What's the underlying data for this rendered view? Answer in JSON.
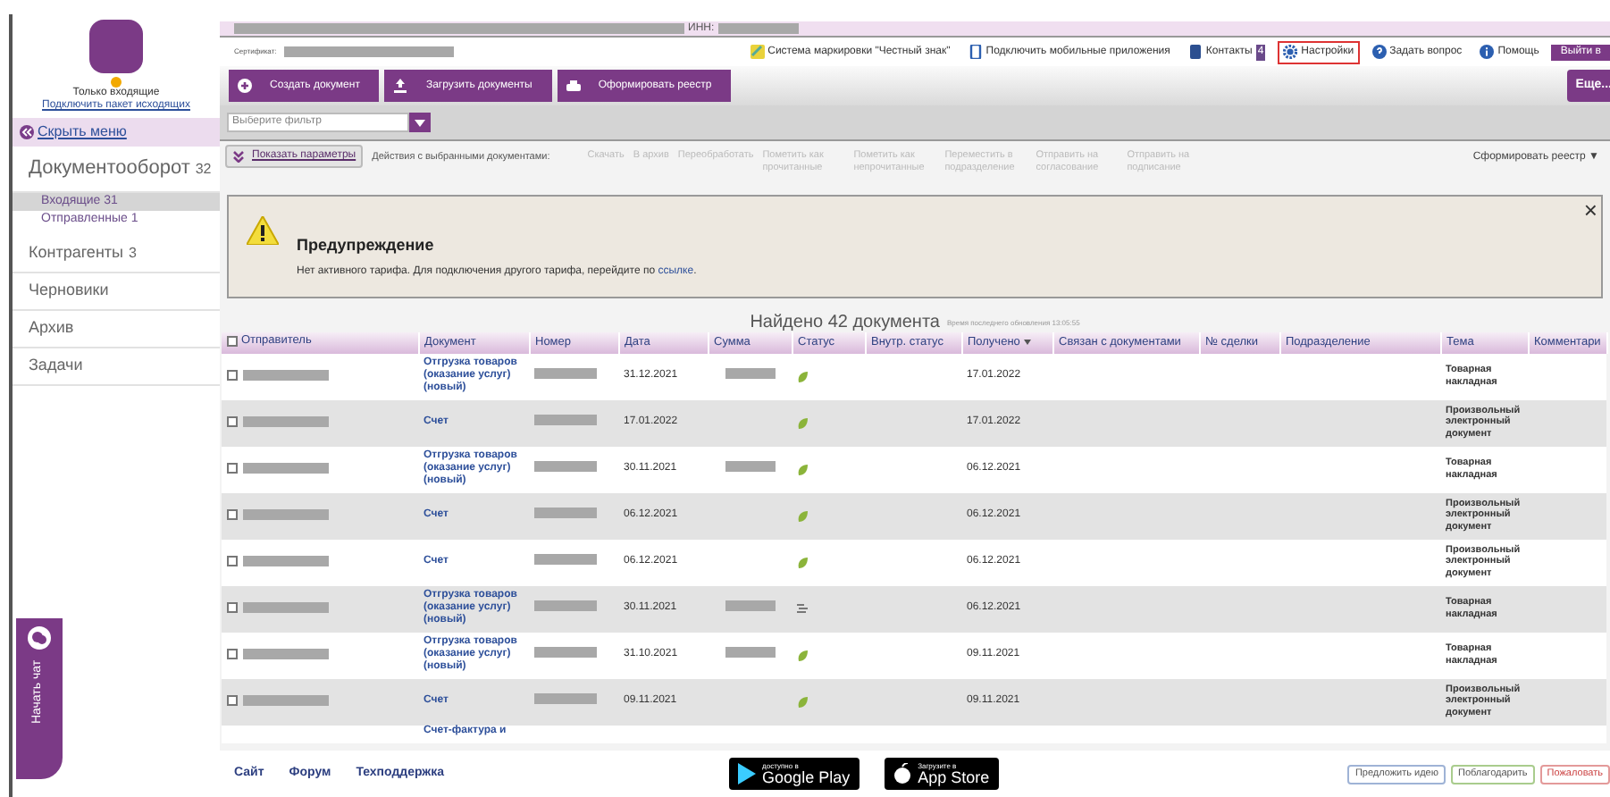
{
  "header": {
    "inn_label": "ИНН:",
    "certificate_label": "Сертификат:",
    "links": [
      {
        "kind": "mark",
        "label": "Система маркировки \"Честный знак\"",
        "highlighted": false
      },
      {
        "kind": "phone",
        "label": "Подключить мобильные приложения",
        "highlighted": false
      },
      {
        "kind": "book",
        "label": "Контакты",
        "badge": "4",
        "highlighted": false
      },
      {
        "kind": "gear",
        "label": "Настройки",
        "highlighted": true
      },
      {
        "kind": "question",
        "label": "Задать вопрос",
        "highlighted": false
      },
      {
        "kind": "info",
        "label": "Помощь",
        "highlighted": false
      }
    ],
    "logout": "Выйти в"
  },
  "sidebar": {
    "plan": "Только входящие",
    "plan_link": "Подключить пакет исходящих",
    "hide_menu": "Скрыть меню",
    "items": [
      {
        "label": "Документооборот",
        "count": "32",
        "children": [
          {
            "label": "Входящие",
            "count": "31",
            "selected": true
          },
          {
            "label": "Отправленные",
            "count": "1",
            "selected": false
          }
        ]
      },
      {
        "label": "Контрагенты",
        "count": "3"
      },
      {
        "label": "Черновики"
      },
      {
        "label": "Архив"
      },
      {
        "label": "Задачи"
      }
    ],
    "chat": "Начать чат"
  },
  "toolbar": {
    "buttons": [
      {
        "kind": "plus",
        "label": "Создать документ"
      },
      {
        "kind": "upload",
        "label": "Загрузить документы"
      },
      {
        "kind": "register",
        "label": "Оформировать реестр"
      }
    ],
    "more": "Еще..."
  },
  "filter": {
    "placeholder": "Выберите фильтр"
  },
  "actions": {
    "show_params": "Показать параметры",
    "label": "Действия с выбранными документами:",
    "items": [
      "Скачать",
      "В архив",
      "Переобработать",
      "Пометить как прочитанные",
      "Пометить как непрочитанные",
      "Переместить в подразделение",
      "Отправить на согласование",
      "Отправить на подписание"
    ],
    "register": "Сформировать реестр ▼"
  },
  "warning": {
    "title": "Предупреждение",
    "text": "Нет активного тарифа. Для подключения другого тарифа, перейдите по",
    "link": "ссылке",
    "end": ".",
    "close": "×"
  },
  "found": {
    "title": "Найдено 42 документа",
    "updated": "Время последнего обновления 13:05:55"
  },
  "table": {
    "select_all_checked": false,
    "columns": [
      {
        "label": "Отправитель",
        "sorted": false
      },
      {
        "label": "Документ",
        "sorted": false
      },
      {
        "label": "Номер",
        "sorted": false
      },
      {
        "label": "Дата",
        "sorted": false
      },
      {
        "label": "Сумма",
        "sorted": false
      },
      {
        "label": "Статус",
        "sorted": false
      },
      {
        "label": "Внутр. статус",
        "sorted": false
      },
      {
        "label": "Получено",
        "sorted": true
      },
      {
        "label": "Связан с документами",
        "sorted": false
      },
      {
        "label": "№ сделки",
        "sorted": false
      },
      {
        "label": "Подразделение",
        "sorted": false
      },
      {
        "label": "Тема",
        "sorted": false
      },
      {
        "label": "Комментари",
        "sorted": false
      }
    ],
    "rows": [
      {
        "checked": false,
        "document": "Отгрузка товаров (оказание услуг) (новый)",
        "date": "31.12.2021",
        "sum_redacted": true,
        "kind": "leaf",
        "received": "17.01.2022",
        "topic": "Товарная накладная"
      },
      {
        "checked": false,
        "document": "Счет",
        "date": "17.01.2022",
        "sum_redacted": false,
        "kind": "leaf",
        "received": "17.01.2022",
        "topic": "Произвольный электронный документ"
      },
      {
        "checked": false,
        "document": "Отгрузка товаров (оказание услуг) (новый)",
        "date": "30.11.2021",
        "sum_redacted": true,
        "kind": "leaf",
        "received": "06.12.2021",
        "topic": "Товарная накладная"
      },
      {
        "checked": false,
        "document": "Счет",
        "date": "06.12.2021",
        "sum_redacted": false,
        "kind": "leaf",
        "received": "06.12.2021",
        "topic": "Произвольный электронный документ"
      },
      {
        "checked": false,
        "document": "Счет",
        "date": "06.12.2021",
        "sum_redacted": false,
        "kind": "leaf",
        "received": "06.12.2021",
        "topic": "Произвольный электронный документ"
      },
      {
        "checked": false,
        "document": "Отгрузка товаров (оказание услуг) (новый)",
        "date": "30.11.2021",
        "sum_redacted": true,
        "kind": "lines",
        "received": "06.12.2021",
        "topic": "Товарная накладная"
      },
      {
        "checked": false,
        "document": "Отгрузка товаров (оказание услуг) (новый)",
        "date": "31.10.2021",
        "sum_redacted": true,
        "kind": "leaf",
        "received": "09.11.2021",
        "topic": "Товарная накладная"
      },
      {
        "checked": false,
        "document": "Счет",
        "date": "09.11.2021",
        "sum_redacted": false,
        "kind": "leaf",
        "received": "09.11.2021",
        "topic": "Произвольный электронный документ"
      }
    ],
    "partial_row": {
      "document": "Счет-фактура и"
    }
  },
  "footer": {
    "links": [
      "Сайт",
      "Форум",
      "Техподдержка"
    ],
    "stores": [
      {
        "kind": "google",
        "small": "доступно в",
        "big": "Google Play"
      },
      {
        "kind": "apple",
        "small": "Загрузите в",
        "big": "App Store"
      }
    ],
    "buttons": [
      {
        "kind": "idea",
        "label": "Предложить идею"
      },
      {
        "kind": "thanks",
        "label": "Поблагодарить"
      },
      {
        "kind": "complain",
        "label": "Пожаловать"
      }
    ]
  }
}
